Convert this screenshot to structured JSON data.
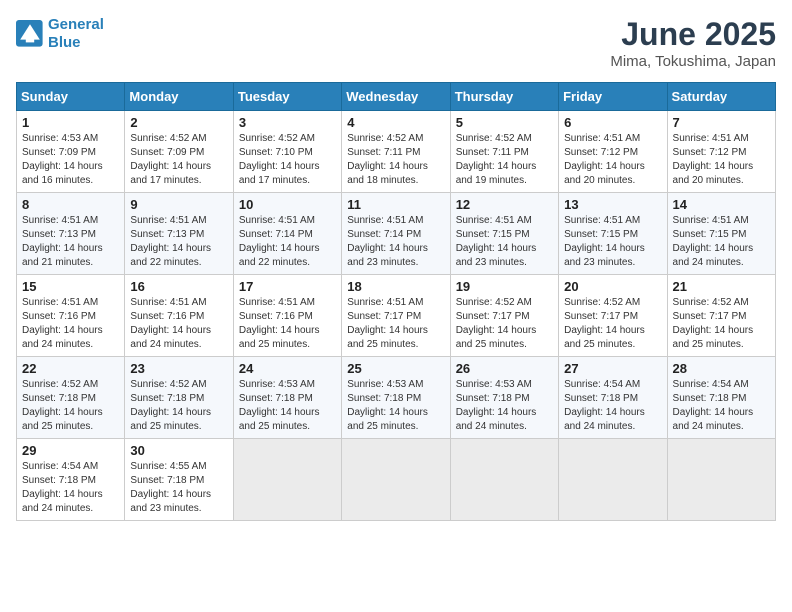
{
  "header": {
    "logo_line1": "General",
    "logo_line2": "Blue",
    "month_year": "June 2025",
    "location": "Mima, Tokushima, Japan"
  },
  "days_of_week": [
    "Sunday",
    "Monday",
    "Tuesday",
    "Wednesday",
    "Thursday",
    "Friday",
    "Saturday"
  ],
  "weeks": [
    [
      {
        "day": 1,
        "lines": [
          "Sunrise: 4:53 AM",
          "Sunset: 7:09 PM",
          "Daylight: 14 hours",
          "and 16 minutes."
        ]
      },
      {
        "day": 2,
        "lines": [
          "Sunrise: 4:52 AM",
          "Sunset: 7:09 PM",
          "Daylight: 14 hours",
          "and 17 minutes."
        ]
      },
      {
        "day": 3,
        "lines": [
          "Sunrise: 4:52 AM",
          "Sunset: 7:10 PM",
          "Daylight: 14 hours",
          "and 17 minutes."
        ]
      },
      {
        "day": 4,
        "lines": [
          "Sunrise: 4:52 AM",
          "Sunset: 7:11 PM",
          "Daylight: 14 hours",
          "and 18 minutes."
        ]
      },
      {
        "day": 5,
        "lines": [
          "Sunrise: 4:52 AM",
          "Sunset: 7:11 PM",
          "Daylight: 14 hours",
          "and 19 minutes."
        ]
      },
      {
        "day": 6,
        "lines": [
          "Sunrise: 4:51 AM",
          "Sunset: 7:12 PM",
          "Daylight: 14 hours",
          "and 20 minutes."
        ]
      },
      {
        "day": 7,
        "lines": [
          "Sunrise: 4:51 AM",
          "Sunset: 7:12 PM",
          "Daylight: 14 hours",
          "and 20 minutes."
        ]
      }
    ],
    [
      {
        "day": 8,
        "lines": [
          "Sunrise: 4:51 AM",
          "Sunset: 7:13 PM",
          "Daylight: 14 hours",
          "and 21 minutes."
        ]
      },
      {
        "day": 9,
        "lines": [
          "Sunrise: 4:51 AM",
          "Sunset: 7:13 PM",
          "Daylight: 14 hours",
          "and 22 minutes."
        ]
      },
      {
        "day": 10,
        "lines": [
          "Sunrise: 4:51 AM",
          "Sunset: 7:14 PM",
          "Daylight: 14 hours",
          "and 22 minutes."
        ]
      },
      {
        "day": 11,
        "lines": [
          "Sunrise: 4:51 AM",
          "Sunset: 7:14 PM",
          "Daylight: 14 hours",
          "and 23 minutes."
        ]
      },
      {
        "day": 12,
        "lines": [
          "Sunrise: 4:51 AM",
          "Sunset: 7:15 PM",
          "Daylight: 14 hours",
          "and 23 minutes."
        ]
      },
      {
        "day": 13,
        "lines": [
          "Sunrise: 4:51 AM",
          "Sunset: 7:15 PM",
          "Daylight: 14 hours",
          "and 23 minutes."
        ]
      },
      {
        "day": 14,
        "lines": [
          "Sunrise: 4:51 AM",
          "Sunset: 7:15 PM",
          "Daylight: 14 hours",
          "and 24 minutes."
        ]
      }
    ],
    [
      {
        "day": 15,
        "lines": [
          "Sunrise: 4:51 AM",
          "Sunset: 7:16 PM",
          "Daylight: 14 hours",
          "and 24 minutes."
        ]
      },
      {
        "day": 16,
        "lines": [
          "Sunrise: 4:51 AM",
          "Sunset: 7:16 PM",
          "Daylight: 14 hours",
          "and 24 minutes."
        ]
      },
      {
        "day": 17,
        "lines": [
          "Sunrise: 4:51 AM",
          "Sunset: 7:16 PM",
          "Daylight: 14 hours",
          "and 25 minutes."
        ]
      },
      {
        "day": 18,
        "lines": [
          "Sunrise: 4:51 AM",
          "Sunset: 7:17 PM",
          "Daylight: 14 hours",
          "and 25 minutes."
        ]
      },
      {
        "day": 19,
        "lines": [
          "Sunrise: 4:52 AM",
          "Sunset: 7:17 PM",
          "Daylight: 14 hours",
          "and 25 minutes."
        ]
      },
      {
        "day": 20,
        "lines": [
          "Sunrise: 4:52 AM",
          "Sunset: 7:17 PM",
          "Daylight: 14 hours",
          "and 25 minutes."
        ]
      },
      {
        "day": 21,
        "lines": [
          "Sunrise: 4:52 AM",
          "Sunset: 7:17 PM",
          "Daylight: 14 hours",
          "and 25 minutes."
        ]
      }
    ],
    [
      {
        "day": 22,
        "lines": [
          "Sunrise: 4:52 AM",
          "Sunset: 7:18 PM",
          "Daylight: 14 hours",
          "and 25 minutes."
        ]
      },
      {
        "day": 23,
        "lines": [
          "Sunrise: 4:52 AM",
          "Sunset: 7:18 PM",
          "Daylight: 14 hours",
          "and 25 minutes."
        ]
      },
      {
        "day": 24,
        "lines": [
          "Sunrise: 4:53 AM",
          "Sunset: 7:18 PM",
          "Daylight: 14 hours",
          "and 25 minutes."
        ]
      },
      {
        "day": 25,
        "lines": [
          "Sunrise: 4:53 AM",
          "Sunset: 7:18 PM",
          "Daylight: 14 hours",
          "and 25 minutes."
        ]
      },
      {
        "day": 26,
        "lines": [
          "Sunrise: 4:53 AM",
          "Sunset: 7:18 PM",
          "Daylight: 14 hours",
          "and 24 minutes."
        ]
      },
      {
        "day": 27,
        "lines": [
          "Sunrise: 4:54 AM",
          "Sunset: 7:18 PM",
          "Daylight: 14 hours",
          "and 24 minutes."
        ]
      },
      {
        "day": 28,
        "lines": [
          "Sunrise: 4:54 AM",
          "Sunset: 7:18 PM",
          "Daylight: 14 hours",
          "and 24 minutes."
        ]
      }
    ],
    [
      {
        "day": 29,
        "lines": [
          "Sunrise: 4:54 AM",
          "Sunset: 7:18 PM",
          "Daylight: 14 hours",
          "and 24 minutes."
        ]
      },
      {
        "day": 30,
        "lines": [
          "Sunrise: 4:55 AM",
          "Sunset: 7:18 PM",
          "Daylight: 14 hours",
          "and 23 minutes."
        ]
      },
      null,
      null,
      null,
      null,
      null
    ]
  ]
}
